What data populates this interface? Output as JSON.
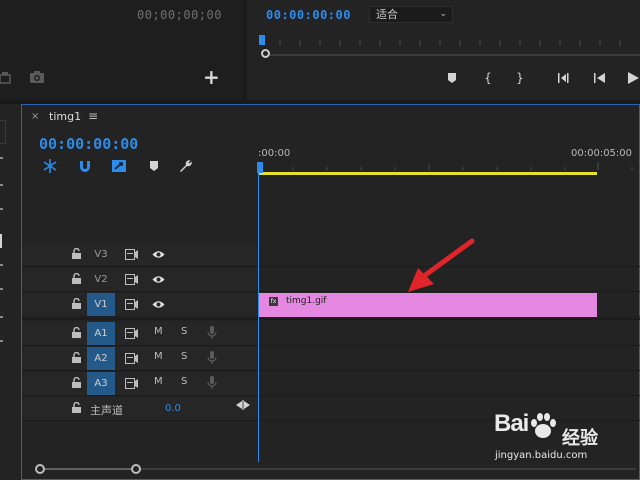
{
  "source_monitor": {
    "timecode": "00;00;00;00"
  },
  "program_monitor": {
    "timecode": "00:00:00:00",
    "fit_select": "适合"
  },
  "timeline": {
    "sequence_tab": "timg1",
    "menu_glyph": "≡",
    "close_glyph": "×",
    "timecode": "00:00:00:00",
    "ruler_start": ":00:00",
    "ruler_end": "00:00:05:00",
    "video_tracks": [
      {
        "name": "V3",
        "targeted": false
      },
      {
        "name": "V2",
        "targeted": false
      },
      {
        "name": "V1",
        "targeted": true
      }
    ],
    "audio_tracks": [
      {
        "name": "A1",
        "mute": "M",
        "solo": "S"
      },
      {
        "name": "A2",
        "mute": "M",
        "solo": "S"
      },
      {
        "name": "A3",
        "mute": "M",
        "solo": "S"
      }
    ],
    "master": {
      "label": "主声道",
      "value": "0.0"
    },
    "clip": {
      "name": "timg1.gif",
      "fx_badge": "fx",
      "color": "#e387e0"
    }
  },
  "watermark": {
    "brand": "Bai",
    "brand_cn": "经验",
    "url": "jingyan.baidu.com"
  },
  "colors": {
    "accent_blue": "#2d8ceb",
    "work_area": "#e6e12a",
    "arrow": "#e0252a"
  },
  "icons": [
    "camera-icon",
    "plus-icon",
    "marker-icon",
    "in-point-icon",
    "out-point-icon",
    "go-to-in-icon",
    "step-back-icon",
    "play-icon",
    "ripple-icon",
    "snap-icon",
    "linked-selection-icon",
    "add-marker-icon",
    "wrench-icon",
    "lock-icon",
    "film-icon",
    "eye-icon",
    "mic-icon"
  ]
}
